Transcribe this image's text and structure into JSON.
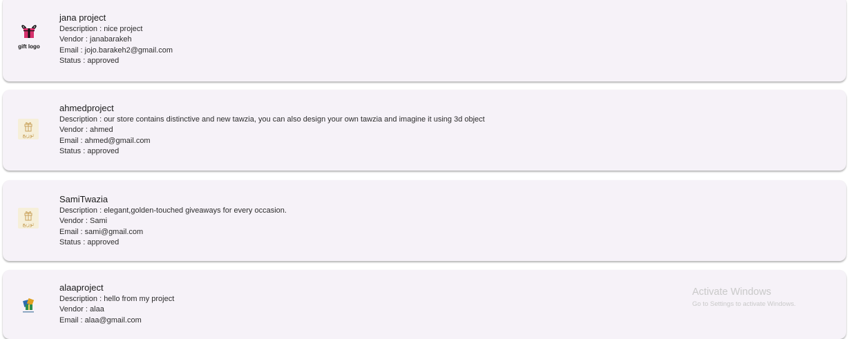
{
  "projects": [
    {
      "title": "jana project",
      "description": "Description : nice project",
      "vendor": "Vendor : janabarakeh",
      "email": "Email : jojo.barakeh2@gmail.com",
      "status": "Status : approved",
      "logo": {
        "icon": "gift-box-icon",
        "text": "gift logo",
        "color": "#d6306c"
      }
    },
    {
      "title": "ahmedproject",
      "description": "Description : our store contains distinctive and new tawzia, you can also design your own tawzia and imagine it using 3d object",
      "vendor": "Vendor : ahmed",
      "email": "Email : ahmed@gmail.com",
      "status": "Status : approved",
      "logo": {
        "icon": "tawzia-gift-icon",
        "text": "توزيع",
        "color": "#c8a15a"
      }
    },
    {
      "title": "SamiTwazia",
      "description": "Description : elegant,golden-touched giveaways for every occasion.",
      "vendor": "Vendor : Sami",
      "email": "Email : sami@gmail.com",
      "status": "Status : approved",
      "logo": {
        "icon": "tawzia-gift-icon",
        "text": "توزيع",
        "color": "#c8a15a"
      }
    },
    {
      "title": "alaaproject",
      "description": "Description : hello from my project",
      "vendor": "Vendor : alaa",
      "email": "Email : alaa@gmail.com",
      "status": "",
      "logo": {
        "icon": "gift-boxes-icon",
        "text": "",
        "color": "#2b6cb0"
      }
    }
  ],
  "watermark": {
    "title": "Activate Windows",
    "subtitle": "Go to Settings to activate Windows."
  },
  "colors": {
    "card_background": "#f6f2f8",
    "page_background": "#ffffff"
  }
}
